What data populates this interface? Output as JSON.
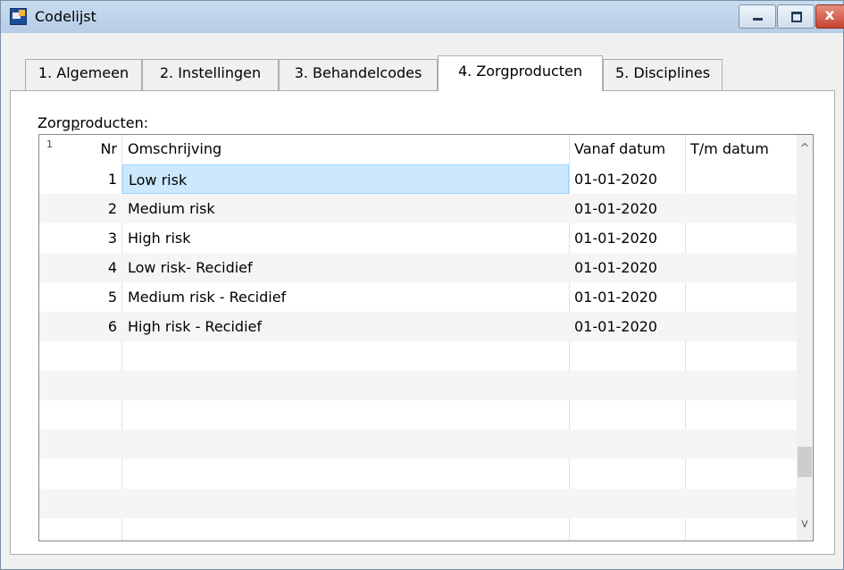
{
  "window": {
    "title": "Codelijst",
    "close_symbol": "x"
  },
  "tabs": [
    {
      "label": "1. Algemeen"
    },
    {
      "label": "2. Instellingen"
    },
    {
      "label": "3. Behandelcodes"
    },
    {
      "label": "4. Zorgproducten",
      "active": true
    },
    {
      "label": "5. Disciplines"
    }
  ],
  "group": {
    "label_pre": "Zorg",
    "label_underlined": "p",
    "label_post": "roducten:"
  },
  "grid": {
    "columns": {
      "nr": "Nr",
      "omschrijving": "Omschrijving",
      "vanaf": "Vanaf datum",
      "tm": "T/m datum"
    },
    "rows": [
      {
        "nr": "1",
        "omschrijving": "Low risk",
        "vanaf": "01-01-2020",
        "tm": ""
      },
      {
        "nr": "2",
        "omschrijving": "Medium risk",
        "vanaf": "01-01-2020",
        "tm": ""
      },
      {
        "nr": "3",
        "omschrijving": "High risk",
        "vanaf": "01-01-2020",
        "tm": ""
      },
      {
        "nr": "4",
        "omschrijving": "Low risk- Recidief",
        "vanaf": "01-01-2020",
        "tm": ""
      },
      {
        "nr": "5",
        "omschrijving": "Medium risk - Recidief",
        "vanaf": "01-01-2020",
        "tm": ""
      },
      {
        "nr": "6",
        "omschrijving": "High risk - Recidief",
        "vanaf": "01-01-2020",
        "tm": ""
      }
    ],
    "selected_row": 0,
    "scroll_up_glyph": "^",
    "scroll_down_glyph": "v",
    "sort_glyph": "1"
  },
  "colors": {
    "selection": "#cce8ff",
    "alt_row": "#f5f5f5"
  }
}
